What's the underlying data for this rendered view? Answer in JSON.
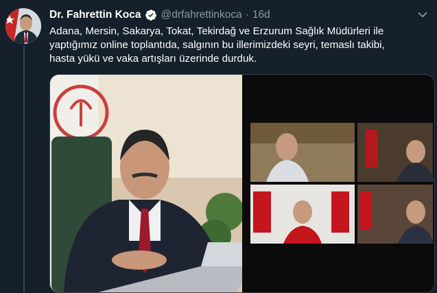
{
  "tweet": {
    "author_name": "Dr. Fahrettin Koca",
    "handle": "@drfahrettinkoca",
    "separator": "·",
    "time": "16d",
    "text": "Adana, Mersin, Sakarya, Tokat, Tekirdağ ve Erzurum Sağlık Müdürleri ile\nyaptığımız online toplantıda, salgının bu illerimizdeki seyri, temaslı takibi,\nhasta yükü ve vaka artışları üzerinde durduk."
  },
  "icons": {
    "verified": "verified-badge-icon",
    "more": "chevron-down-icon"
  },
  "colors": {
    "background": "#15202b",
    "text": "#ffffff",
    "secondary_text": "#8899a6",
    "verified_badge": "#ffffff",
    "divider": "#38444d"
  }
}
